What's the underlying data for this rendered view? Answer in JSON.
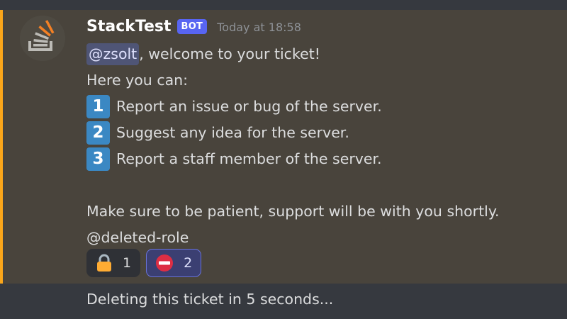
{
  "message": {
    "author": "StackTest",
    "bot_tag": "BOT",
    "timestamp": "Today at 18:58",
    "mention": "@zsolt",
    "welcome": ", welcome to your ticket!",
    "intro": "Here you can:",
    "options": [
      {
        "number": "1",
        "text": "Report an issue or bug of the server."
      },
      {
        "number": "2",
        "text": "Suggest any idea for the server."
      },
      {
        "number": "3",
        "text": "Report a staff member of the server."
      }
    ],
    "closing": "Make sure to be patient, support will be with you shortly.",
    "role_mention": "@deleted-role",
    "reactions": [
      {
        "emoji": "lock",
        "count": "1"
      },
      {
        "emoji": "no-entry",
        "count": "2"
      }
    ]
  },
  "next_message": {
    "text": "Deleting this ticket in 5 seconds..."
  },
  "colors": {
    "background": "#36393f",
    "highlight": "#49443c",
    "accent": "#faa61a",
    "bot_tag": "#5865f2",
    "mention_bg": "#4f5576",
    "number_emoji": "#3b88c3"
  }
}
